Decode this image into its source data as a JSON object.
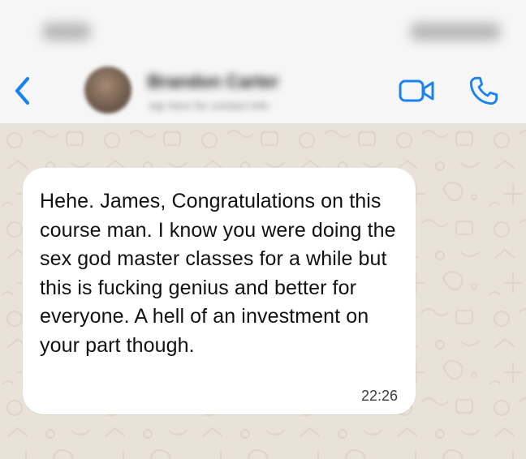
{
  "status_bar": {
    "time": "9:41",
    "indicators": "signal wifi battery"
  },
  "header": {
    "back_icon": "chevron-left-icon",
    "contact_name": "Brandon Carter",
    "contact_subtitle": "tap here for contact info",
    "video_icon": "video-camera-icon",
    "phone_icon": "phone-icon",
    "accent_color": "#1a82f4"
  },
  "chat": {
    "wallpaper_color": "#e9e2d8",
    "bubble_color": "#ffffff",
    "messages": [
      {
        "text": "Hehe. James, Congratulations on this course man. I know you were doing the sex god master classes for a while but this is fucking genius and better for everyone. A hell of an investment on your part though.",
        "time": "22:26"
      }
    ]
  }
}
